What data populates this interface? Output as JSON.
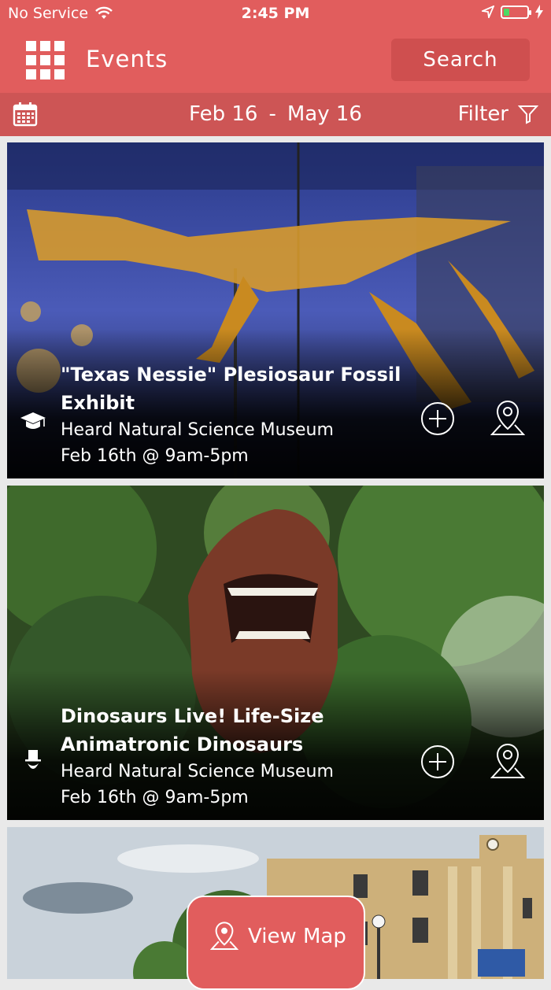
{
  "status": {
    "carrier": "No Service",
    "time": "2:45 PM"
  },
  "nav": {
    "title": "Events",
    "search_label": "Search"
  },
  "datebar": {
    "start": "Feb 16",
    "separator": "-",
    "end": "May 16",
    "filter_label": "Filter"
  },
  "events": [
    {
      "title": "\"Texas Nessie\" Plesiosaur Fossil Exhibit",
      "venue": "Heard Natural Science Museum",
      "time": "Feb 16th @ 9am-5pm",
      "category_icon": "graduation-cap-icon"
    },
    {
      "title": "Dinosaurs Live! Life-Size Animatronic Dinosaurs",
      "venue": "Heard Natural Science Museum",
      "time": "Feb 16th @ 9am-5pm",
      "category_icon": "top-hat-icon"
    }
  ],
  "view_map_label": "View Map",
  "colors": {
    "brand": "#e15d5d",
    "datebar": "#cd5555",
    "search_button": "#cf4f4f"
  }
}
